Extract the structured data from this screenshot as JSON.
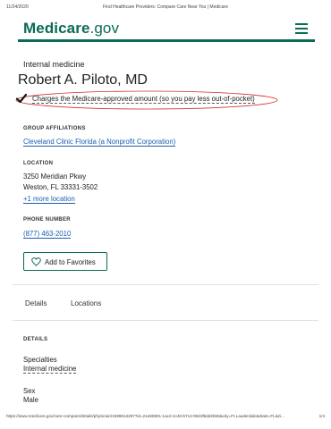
{
  "print_header": {
    "date": "11/24/2020",
    "title": "Find Healthcare Providers: Compare Care Near You | Medicare"
  },
  "header": {
    "logo_brand": "Medicare",
    "logo_tld": ".gov",
    "menu_icon": "hamburger-menu-icon",
    "accent_color": "#0b6b57"
  },
  "provider": {
    "specialty": "Internal medicine",
    "name": "Robert A. Piloto, MD",
    "assignment_text": "Charges the Medicare-approved amount (so you pay less out-of-pocket)",
    "assignment_icon": "checkmark-icon",
    "annotation_color": "#d32f2f"
  },
  "group_affiliations": {
    "label": "GROUP AFFILIATIONS",
    "link": "Cleveland Clinic Florida (a Nonprofit Corporation)"
  },
  "location": {
    "label": "LOCATION",
    "address_line1": "3250 Meridian Pkwy",
    "address_line2": "Weston, FL 33331-3502",
    "more_link": "+1 more location"
  },
  "phone": {
    "label": "PHONE NUMBER",
    "number": "(877) 463-2010"
  },
  "favorites_button": {
    "label": "Add to Favorites",
    "icon": "heart-outline-icon"
  },
  "tabs": [
    {
      "label": "Details"
    },
    {
      "label": "Locations"
    }
  ],
  "details": {
    "heading": "DETAILS",
    "specialties_label": "Specialties",
    "specialties_value": "Internal medicine",
    "sex_label": "Sex",
    "sex_value": "Male"
  },
  "print_footer": {
    "url": "https://www.medicare.gov/care-compare/details/physician/1699613297?id=21e80801-1ac2-4c40-b712-9633f6dd2b56&city=Ft.Lauderdale&state=FL&zi...",
    "page": "1/4"
  }
}
